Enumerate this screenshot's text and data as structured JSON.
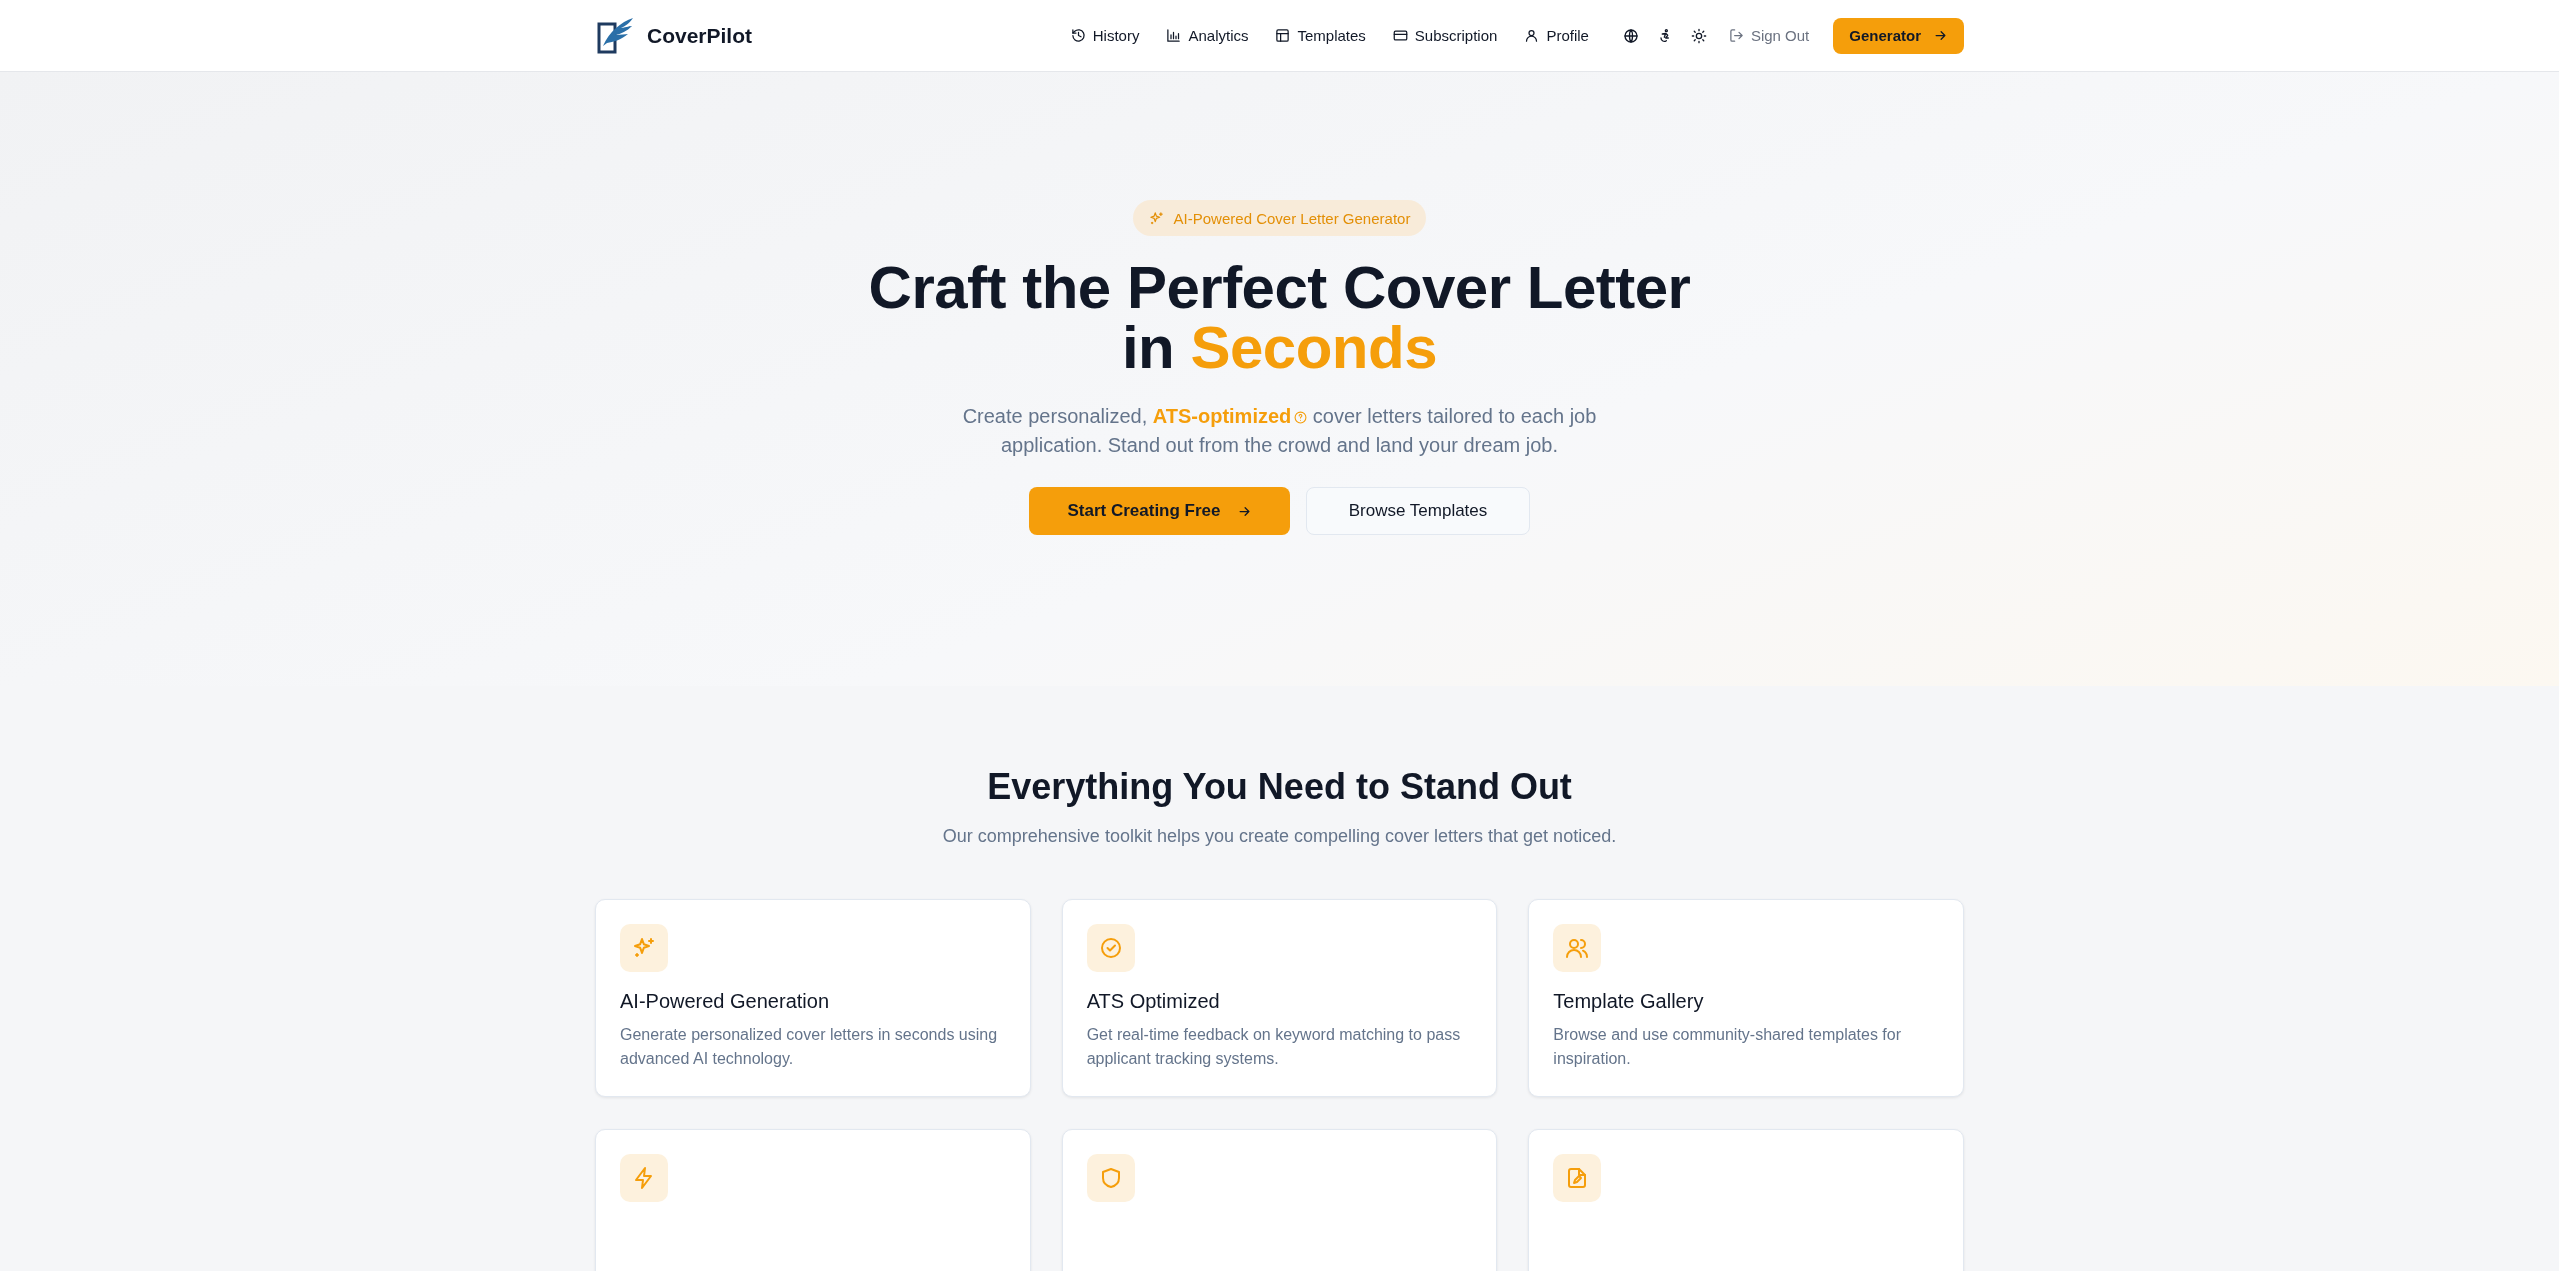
{
  "header": {
    "brand": "CoverPilot",
    "nav": [
      {
        "label": "History"
      },
      {
        "label": "Analytics"
      },
      {
        "label": "Templates"
      },
      {
        "label": "Subscription"
      },
      {
        "label": "Profile"
      }
    ],
    "sign_out": "Sign Out",
    "cta": "Generator"
  },
  "hero": {
    "badge": "AI-Powered Cover Letter Generator",
    "title_line_1": "Craft the Perfect Cover Letter",
    "title_line_2": "in",
    "title_highlight": "Seconds",
    "subtitle_before": "Create personalized,",
    "subtitle_term": "ATS-optimized",
    "subtitle_after": "cover letters tailored to each job application. Stand out from the crowd and land your dream job.",
    "primary_button": "Start Creating Free",
    "secondary_button": "Browse Templates"
  },
  "features": {
    "title": "Everything You Need to Stand Out",
    "subtitle": "Our comprehensive toolkit helps you create compelling cover letters that get noticed.",
    "cards": [
      {
        "kind": "full",
        "title": "AI-Powered Generation",
        "description": "Generate personalized cover letters in seconds using advanced AI technology."
      },
      {
        "kind": "full",
        "title": "ATS Optimized",
        "description": "Get real-time feedback on keyword matching to pass applicant tracking systems."
      },
      {
        "kind": "full",
        "title": "Template Gallery",
        "description": "Browse and use community-shared templates for inspiration."
      },
      {
        "kind": "clipped"
      },
      {
        "kind": "clipped"
      },
      {
        "kind": "clipped"
      }
    ]
  }
}
